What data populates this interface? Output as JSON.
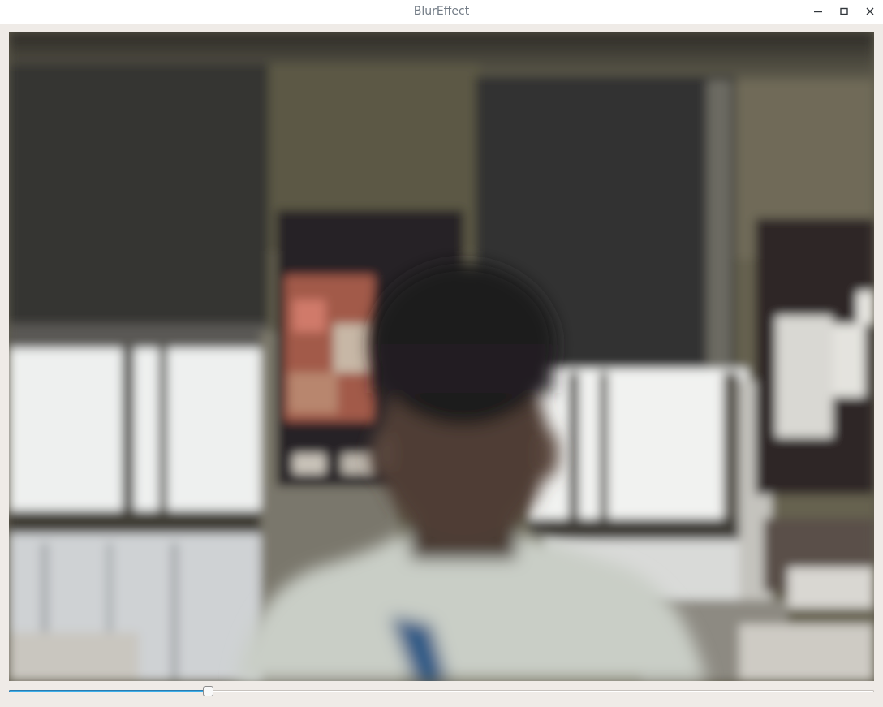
{
  "window": {
    "title": "BlurEffect",
    "controls": [
      "minimize-icon",
      "maximize-icon",
      "close-icon"
    ]
  },
  "video": {
    "description_icon": "camera-feed"
  },
  "blur_slider": {
    "value_fraction": 0.23
  },
  "colors": {
    "accent": "#3daee9",
    "window_bg": "#efebe7",
    "title_text": "#737c86"
  }
}
